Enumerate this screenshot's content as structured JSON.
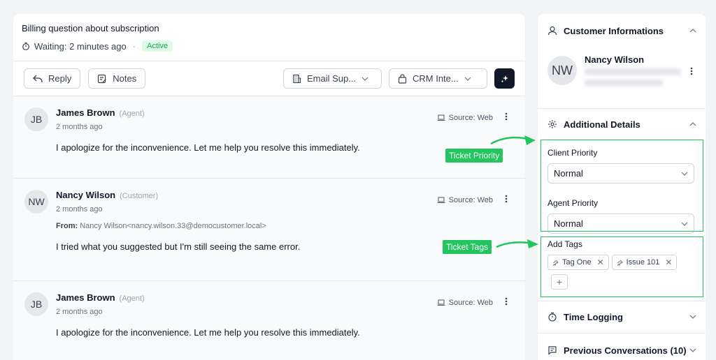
{
  "ticket": {
    "title": "Billing question about subscription",
    "waiting": "Waiting: 2 minutes ago",
    "separator": "·",
    "status": "Active"
  },
  "toolbar": {
    "reply_label": "Reply",
    "notes_label": "Notes",
    "email_dropdown": "Email Sup...",
    "crm_dropdown": "CRM Inte..."
  },
  "messages": [
    {
      "initials": "JB",
      "name": "James Brown",
      "role": "(Agent)",
      "time": "2 months ago",
      "source": "Source: Web",
      "body": "I apologize for the inconvenience. Let me help you resolve this immediately."
    },
    {
      "initials": "NW",
      "name": "Nancy Wilson",
      "role": "(Customer)",
      "time": "2 months ago",
      "source": "Source: Web",
      "from_label": "From:",
      "from_value": "Nancy Wilson<nancy.wilson.33@democustomer.local>",
      "body": "I tried what you suggested but I'm still seeing the same error."
    },
    {
      "initials": "JB",
      "name": "James Brown",
      "role": "(Agent)",
      "time": "2 months ago",
      "source": "Source: Web",
      "body": "I apologize for the inconvenience. Let me help you resolve this immediately."
    }
  ],
  "sidebar": {
    "customer_section": "Customer Informations",
    "customer_initials": "NW",
    "customer_name": "Nancy Wilson",
    "details_section": "Additional Details",
    "client_priority_label": "Client Priority",
    "client_priority_value": "Normal",
    "agent_priority_label": "Agent Priority",
    "agent_priority_value": "Normal",
    "tags_label": "Add Tags",
    "tags": [
      "Tag One",
      "Issue 101"
    ],
    "add_tag_symbol": "+",
    "time_logging": "Time Logging",
    "previous_conversations": "Previous Conversations (10)"
  },
  "annotations": {
    "priority": "Ticket Priority",
    "tags": "Ticket Tags"
  },
  "colors": {
    "accent_green": "#22c55e",
    "active_badge_bg": "#dcfce7",
    "dark_button": "#111827"
  }
}
